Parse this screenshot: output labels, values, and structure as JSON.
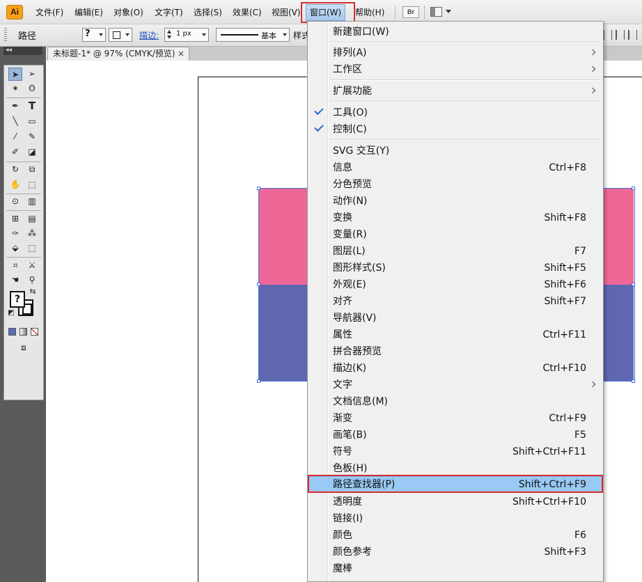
{
  "app": {
    "logo": "Ai"
  },
  "menubar": {
    "items": [
      {
        "label": "文件(F)"
      },
      {
        "label": "编辑(E)"
      },
      {
        "label": "对象(O)"
      },
      {
        "label": "文字(T)"
      },
      {
        "label": "选择(S)"
      },
      {
        "label": "效果(C)"
      },
      {
        "label": "视图(V)"
      },
      {
        "label": "窗口(W)",
        "active": true
      },
      {
        "label": "帮助(H)"
      }
    ],
    "bridge_label": "Br"
  },
  "controlbar": {
    "selection_label": "路径",
    "fill_value": "?",
    "stroke_label": "描边:",
    "stroke_weight": "1 px",
    "stroke_profile": "基本",
    "style_label": "样式"
  },
  "toolbox": {
    "fill_value": "?"
  },
  "document": {
    "tab_title": "未标题-1* @ 97% (CMYK/预览)",
    "close_glyph": "×"
  },
  "colors": {
    "pink_rect": "#ef6796",
    "blue_rect": "#6067b1",
    "selection": "#4a6ddc",
    "highlight_outline": "#d62d2d",
    "menu_hover": "#99c9f4"
  },
  "window_menu": {
    "items": [
      {
        "label": "新建窗口(W)",
        "shortcut": ""
      },
      {
        "label": "排列(A)",
        "submenu": true
      },
      {
        "label": "工作区",
        "submenu": true
      },
      {
        "label": "扩展功能",
        "submenu": true
      },
      {
        "label": "工具(O)",
        "checked": true
      },
      {
        "label": "控制(C)",
        "checked": true
      },
      {
        "label": "SVG 交互(Y)",
        "shortcut": ""
      },
      {
        "label": "信息",
        "shortcut": "Ctrl+F8"
      },
      {
        "label": "分色预览",
        "shortcut": ""
      },
      {
        "label": "动作(N)",
        "shortcut": ""
      },
      {
        "label": "变换",
        "shortcut": "Shift+F8"
      },
      {
        "label": "变量(R)",
        "shortcut": ""
      },
      {
        "label": "图层(L)",
        "shortcut": "F7"
      },
      {
        "label": "图形样式(S)",
        "shortcut": "Shift+F5"
      },
      {
        "label": "外观(E)",
        "shortcut": "Shift+F6"
      },
      {
        "label": "对齐",
        "shortcut": "Shift+F7"
      },
      {
        "label": "导航器(V)",
        "shortcut": ""
      },
      {
        "label": "属性",
        "shortcut": "Ctrl+F11"
      },
      {
        "label": "拼合器预览",
        "shortcut": ""
      },
      {
        "label": "描边(K)",
        "shortcut": "Ctrl+F10"
      },
      {
        "label": "文字",
        "submenu": true
      },
      {
        "label": "文档信息(M)",
        "shortcut": ""
      },
      {
        "label": "渐变",
        "shortcut": "Ctrl+F9"
      },
      {
        "label": "画笔(B)",
        "shortcut": "F5"
      },
      {
        "label": "符号",
        "shortcut": "Shift+Ctrl+F11"
      },
      {
        "label": "色板(H)",
        "shortcut": ""
      },
      {
        "label": "路径查找器(P)",
        "shortcut": "Shift+Ctrl+F9",
        "highlighted": true
      },
      {
        "label": "透明度",
        "shortcut": "Shift+Ctrl+F10"
      },
      {
        "label": "链接(I)",
        "shortcut": ""
      },
      {
        "label": "颜色",
        "shortcut": "F6"
      },
      {
        "label": "颜色参考",
        "shortcut": "Shift+F3"
      },
      {
        "label": "魔棒",
        "shortcut": ""
      }
    ]
  }
}
